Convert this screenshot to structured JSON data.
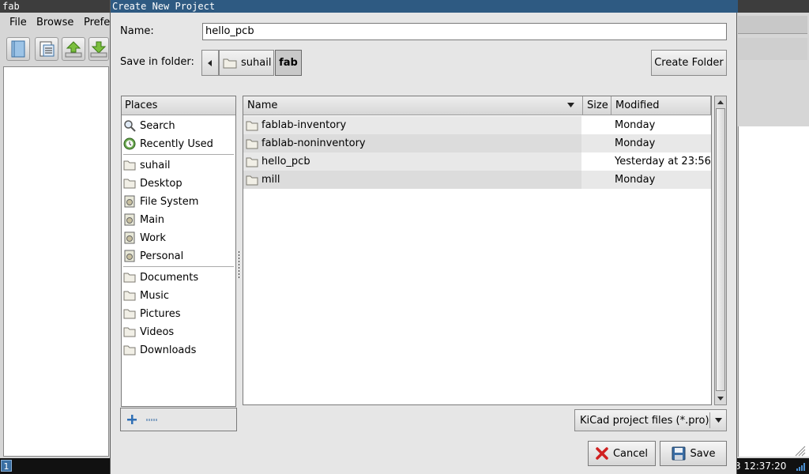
{
  "background_window": {
    "title": "fab",
    "menu": [
      "File",
      "Browse",
      "Prefe"
    ],
    "toolbar_icons": [
      "new-document-icon",
      "open-list-icon",
      "upload-icon",
      "download-icon"
    ]
  },
  "taskbar": {
    "workspace": "1",
    "clock": "3 12:37:20"
  },
  "dialog": {
    "title": "Create New Project",
    "name_label": "Name:",
    "name_value": "hello_pcb",
    "folder_label": "Save in folder:",
    "path": [
      "suhail",
      "fab"
    ],
    "create_folder": "Create Folder",
    "places_header": "Places",
    "places_group1": [
      {
        "label": "Search",
        "icon": "search-icon"
      },
      {
        "label": "Recently Used",
        "icon": "recent-icon"
      }
    ],
    "places_group2": [
      {
        "label": "suhail",
        "icon": "folder-icon"
      },
      {
        "label": "Desktop",
        "icon": "folder-icon"
      },
      {
        "label": "File System",
        "icon": "drive-icon"
      },
      {
        "label": "Main",
        "icon": "drive-icon"
      },
      {
        "label": "Work",
        "icon": "drive-icon"
      },
      {
        "label": "Personal",
        "icon": "drive-icon"
      }
    ],
    "places_group3": [
      {
        "label": "Documents",
        "icon": "folder-icon"
      },
      {
        "label": "Music",
        "icon": "folder-icon"
      },
      {
        "label": "Pictures",
        "icon": "folder-icon"
      },
      {
        "label": "Videos",
        "icon": "folder-icon"
      },
      {
        "label": "Downloads",
        "icon": "folder-icon"
      }
    ],
    "columns": {
      "name": "Name",
      "size": "Size",
      "modified": "Modified"
    },
    "files": [
      {
        "name": "fablab-inventory",
        "size": "",
        "modified": "Monday"
      },
      {
        "name": "fablab-noninventory",
        "size": "",
        "modified": "Monday"
      },
      {
        "name": "hello_pcb",
        "size": "",
        "modified": "Yesterday at 23:56"
      },
      {
        "name": "mill",
        "size": "",
        "modified": "Monday"
      }
    ],
    "filter": "KiCad project files (*.pro)",
    "cancel": "Cancel",
    "save": "Save"
  },
  "colors": {
    "titlebar": "#2e5a82",
    "dialog_bg": "#e6e6e6",
    "row_alt": "#e8e8e8",
    "accent": "#2f6fb5"
  }
}
